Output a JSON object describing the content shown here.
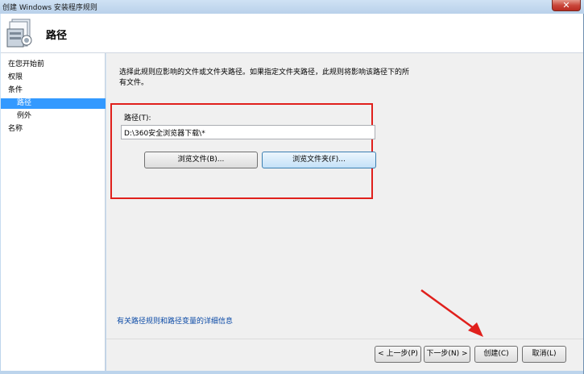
{
  "window": {
    "title": "创建 Windows 安装程序规则",
    "close_label": "✕"
  },
  "header": {
    "title": "路径",
    "icon": "rule-wizard-icon"
  },
  "sidebar": {
    "items": [
      {
        "label": "在您开始前"
      },
      {
        "label": "权限"
      },
      {
        "label": "条件"
      },
      {
        "label": "路径"
      },
      {
        "label": "例外"
      },
      {
        "label": "名称"
      }
    ]
  },
  "main": {
    "description": "选择此规则应影响的文件或文件夹路径。如果指定文件夹路径，此规则将影响该路径下的所有文件。",
    "path_label": "路径(T):",
    "path_value": "D:\\360安全浏览器下载\\*",
    "browse_files_label": "浏览文件(B)...",
    "browse_folders_label": "浏览文件夹(F)...",
    "info_link": "有关路径规则和路径变量的详细信息"
  },
  "footer": {
    "back_label": "< 上一步(P)",
    "next_label": "下一步(N) >",
    "create_label": "创建(C)",
    "cancel_label": "取消(L)"
  },
  "colors": {
    "selection": "#3399ff",
    "annotation_red": "#e0201c",
    "link": "#0b4aa6"
  }
}
